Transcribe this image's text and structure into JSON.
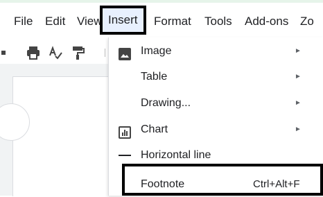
{
  "menubar": {
    "items": [
      {
        "label": "File"
      },
      {
        "label": "Edit"
      },
      {
        "label": "View"
      },
      {
        "label": "Insert"
      },
      {
        "label": "Format"
      },
      {
        "label": "Tools"
      },
      {
        "label": "Add-ons"
      },
      {
        "label": "Zo"
      }
    ],
    "open_item": "Insert"
  },
  "toolbar": {
    "icons": [
      "print-icon",
      "spellcheck-icon",
      "paint-format-icon"
    ]
  },
  "insert_menu": {
    "items": [
      {
        "label": "Image",
        "icon": "image-icon",
        "has_submenu": true
      },
      {
        "label": "Table",
        "icon": "",
        "has_submenu": true
      },
      {
        "label": "Drawing...",
        "icon": "",
        "has_submenu": true
      },
      {
        "label": "Chart",
        "icon": "chart-icon",
        "has_submenu": true
      },
      {
        "label": "Horizontal line",
        "icon": "horizontal-line-icon",
        "has_submenu": false
      },
      {
        "label": "Footnote",
        "icon": "",
        "has_submenu": false,
        "shortcut": "Ctrl+Alt+F",
        "highlighted": true
      }
    ],
    "submenu_arrow": "►"
  },
  "colors": {
    "menu_open_bg": "#e8f0fe",
    "highlight_border": "#000000",
    "doc_bg": "#f1f3f4",
    "text": "#202124"
  }
}
